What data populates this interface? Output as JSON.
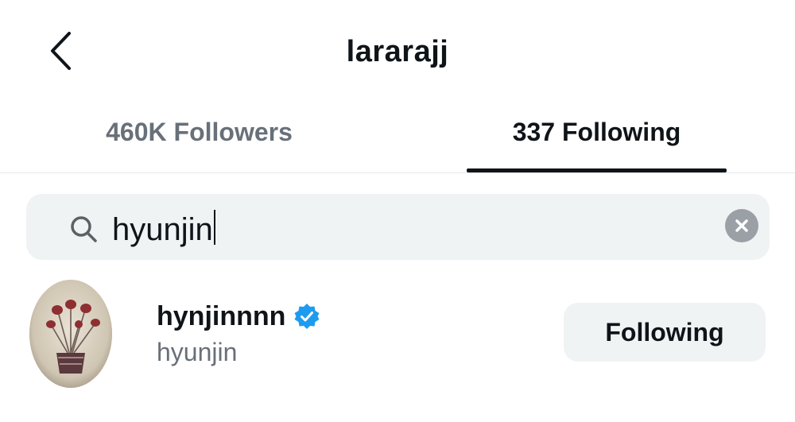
{
  "header": {
    "title": "lararajj",
    "back_icon": "chevron-left-icon"
  },
  "tabs": [
    {
      "label": "460K Followers",
      "active": false
    },
    {
      "label": "337 Following",
      "active": true
    }
  ],
  "search": {
    "value": "hyunjin",
    "search_icon": "search-icon",
    "clear_icon": "clear-icon"
  },
  "results": [
    {
      "display_name": "hynjinnnn",
      "verified": true,
      "handle": "hyunjin",
      "button_label": "Following"
    }
  ],
  "colors": {
    "text_primary": "#0f1419",
    "text_secondary": "#687079",
    "verified_blue": "#1d9bf0",
    "field_bg": "#eff3f4"
  }
}
